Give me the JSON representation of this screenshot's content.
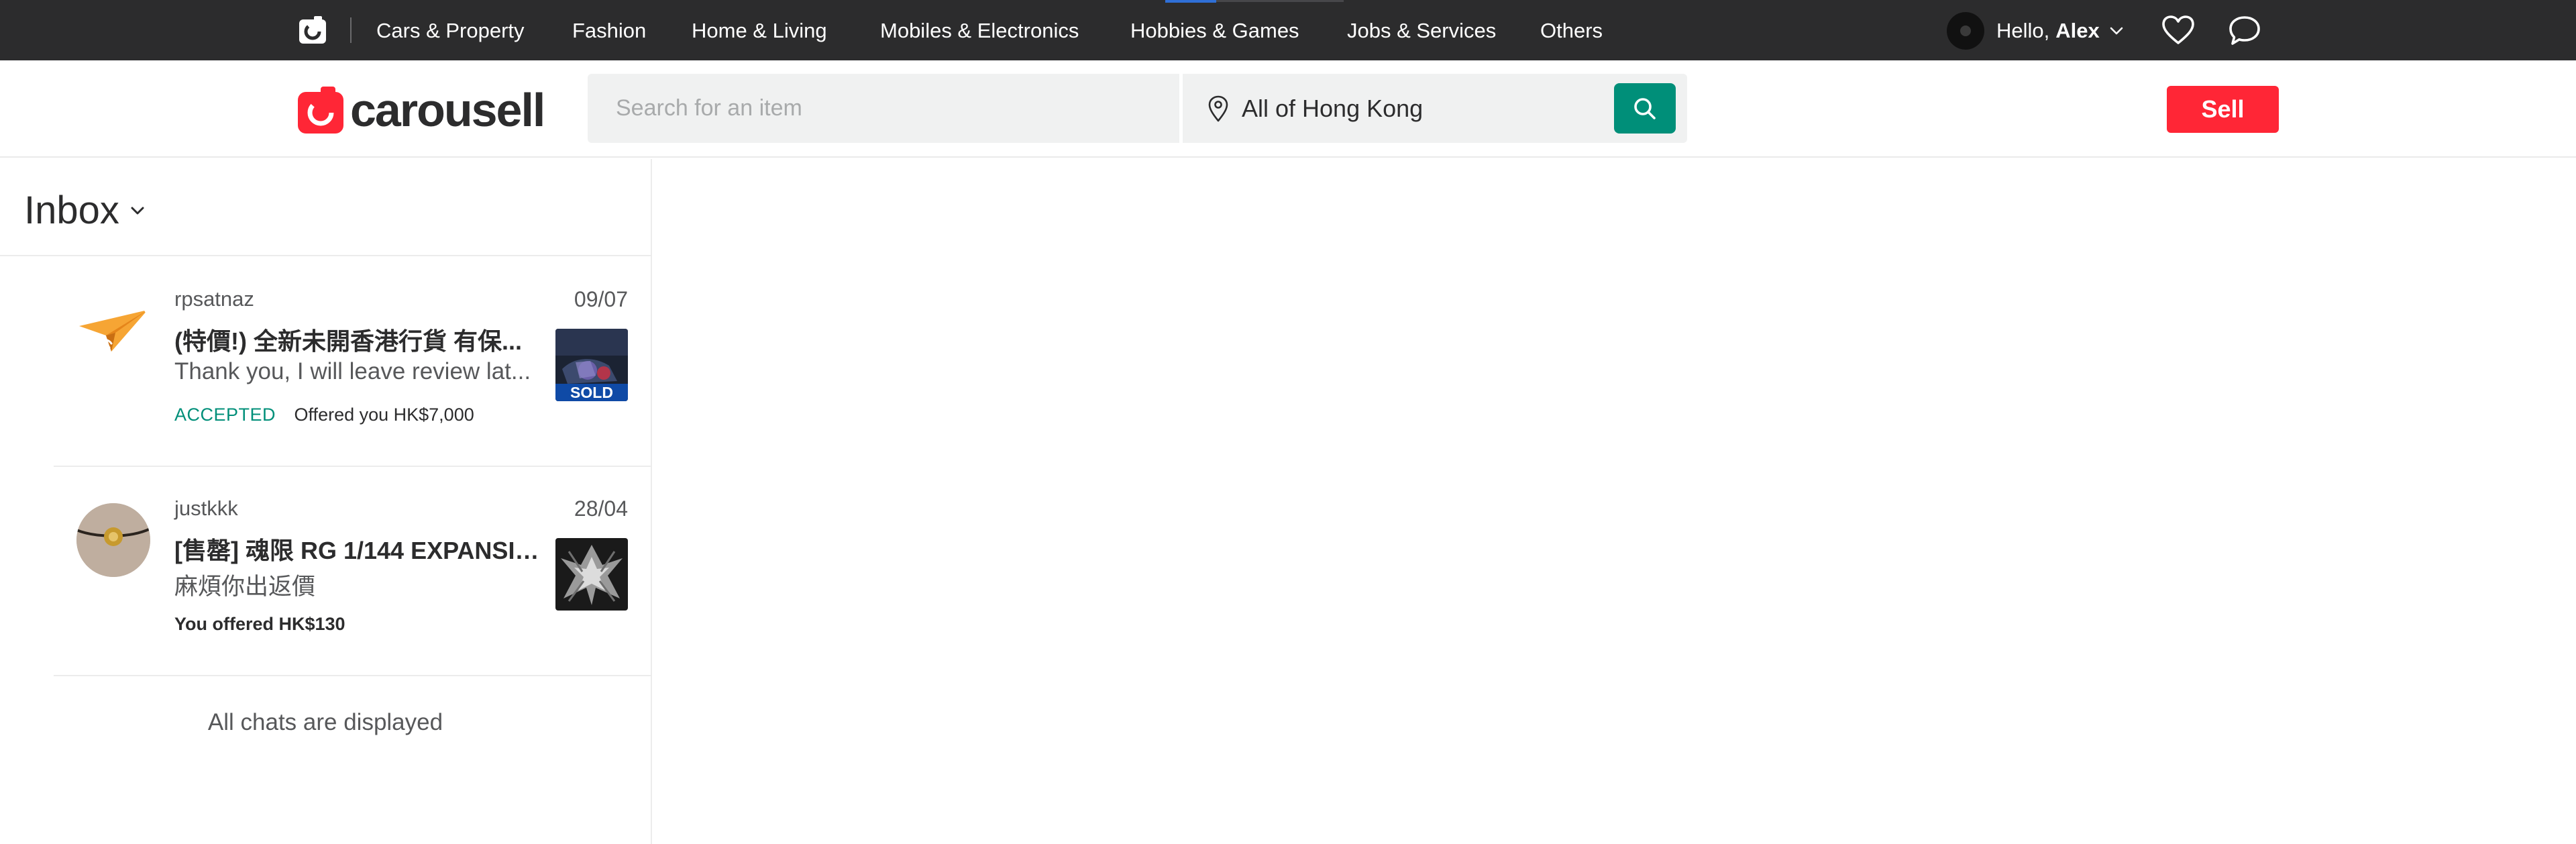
{
  "topbar": {
    "categories": [
      "Cars & Property",
      "Fashion",
      "Home & Living",
      "Mobiles & Electronics",
      "Hobbies & Games",
      "Jobs & Services",
      "Others"
    ],
    "greeting": "Hello,",
    "user_name": "Alex"
  },
  "header": {
    "brand": "carousell",
    "search_placeholder": "Search for an item",
    "location": "All of Hong Kong",
    "sell_label": "Sell"
  },
  "colors": {
    "brand_red": "#ff2636",
    "accent_green": "#008f79",
    "topbar_bg": "#2c2c2d"
  },
  "inbox": {
    "title": "Inbox",
    "chats": [
      {
        "user": "rpsatnaz",
        "date": "09/07",
        "product": "(特價!) 全新未開香港行貨 有保...",
        "message": "Thank you, I will leave review lat...",
        "status": "ACCEPTED",
        "offer": "Offered you HK$7,000",
        "badge": "SOLD"
      },
      {
        "user": "justkkk",
        "date": "28/04",
        "product": "[售罄] 魂限 RG 1/144 EXPANSIO...",
        "message": "麻煩你出返價",
        "offer": "You offered HK$130"
      }
    ],
    "footer": "All chats are displayed"
  }
}
